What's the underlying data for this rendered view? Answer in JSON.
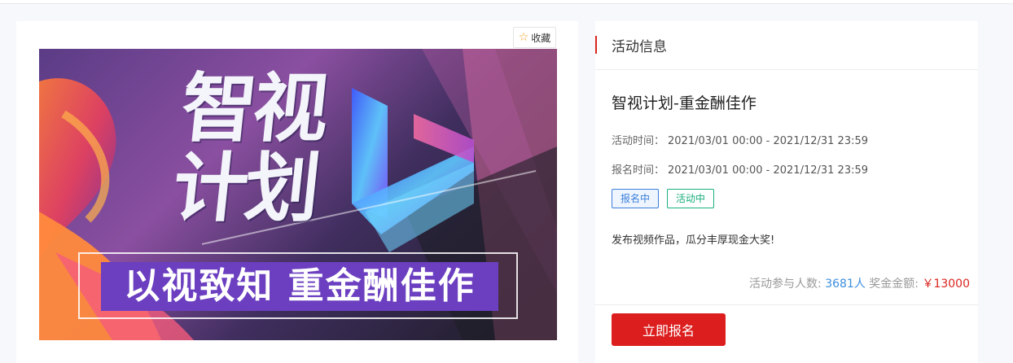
{
  "favorite": {
    "label": "收藏",
    "icon": "star-outline-icon"
  },
  "banner": {
    "title": "智视计划",
    "slogan": "以视致知 重金酬佳作"
  },
  "info": {
    "section_title": "活动信息",
    "event_name": "智视计划-重金酬佳作",
    "activity_time_label": "活动时间：",
    "activity_time_value": "2021/03/01 00:00 - 2021/12/31 23:59",
    "signup_time_label": "报名时间：",
    "signup_time_value": "2021/03/01 00:00 - 2021/12/31 23:59",
    "tags": [
      "报名中",
      "活动中"
    ],
    "description": "发布视频作品，瓜分丰厚现金大奖!",
    "participants_label": "活动参与人数:",
    "participants_value": "3681人",
    "prize_label": "奖金金额:",
    "prize_value": "￥13000",
    "signup_button": "立即报名"
  },
  "colors": {
    "accent_red": "#dc1e1e",
    "tag_blue": "#3b7fd9",
    "tag_green": "#1aaf7a"
  }
}
